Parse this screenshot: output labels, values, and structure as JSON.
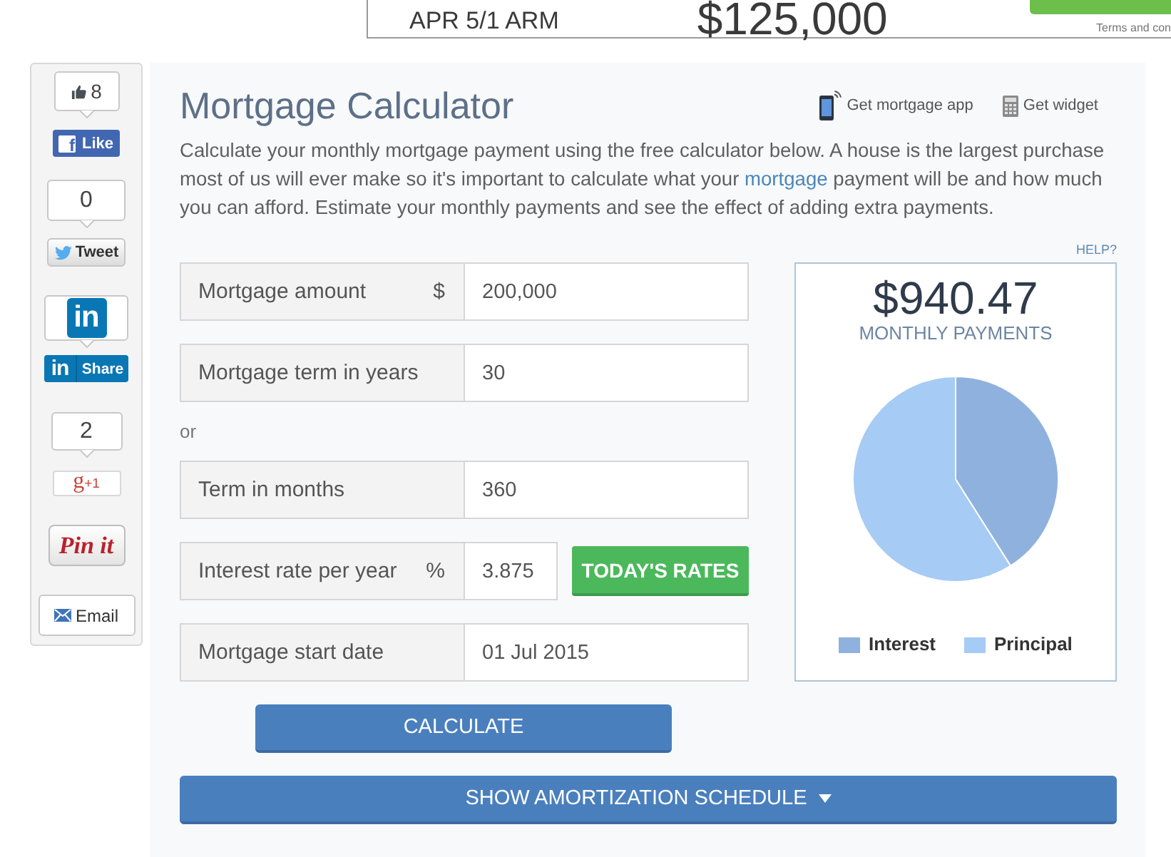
{
  "ad_banner": {
    "rate_type": "APR 5/1 ARM",
    "amount": "$125,000",
    "fine_print": "Terms and con"
  },
  "share_bar": [
    {
      "kind": "facebook",
      "count": "8",
      "logo": "f",
      "label": "Like"
    },
    {
      "kind": "twitter",
      "count": "0",
      "label": "Tweet"
    },
    {
      "kind": "linkedin",
      "logo": "in",
      "button_logo": "in",
      "label": "Share"
    },
    {
      "kind": "google",
      "count": "2",
      "logo": "g",
      "label": "+1"
    },
    {
      "kind": "pinterest",
      "label": "Pin it"
    },
    {
      "kind": "email",
      "label": "Email"
    }
  ],
  "calculator": {
    "title": "Mortgage Calculator",
    "links": [
      {
        "kind": "app",
        "label": "Get mortgage app"
      },
      {
        "kind": "widget",
        "label": "Get widget"
      }
    ],
    "intro": {
      "before": "Calculate your monthly mortgage payment using the free calculator below. A house is the largest purchase most of us will ever make so it's important to calculate what your ",
      "link": "mortgage",
      "after": " payment will be and how much you can afford. Estimate your monthly payments and see the effect of adding extra payments."
    },
    "help": "HELP?",
    "rows": [
      {
        "kind": "field",
        "label": "Mortgage amount",
        "unit": "$",
        "value": "200,000"
      },
      {
        "kind": "field",
        "label": "Mortgage term in years",
        "value": "30"
      },
      {
        "kind": "separator",
        "text": "or"
      },
      {
        "kind": "field",
        "label": "Term in months",
        "value": "360"
      },
      {
        "kind": "field",
        "label": "Interest rate per year",
        "unit": "%",
        "value": "3.875",
        "button": "TODAY'S RATES"
      },
      {
        "kind": "field",
        "label": "Mortgage start date",
        "value": "01 Jul 2015"
      }
    ],
    "calculate_button": "CALCULATE",
    "result": {
      "amount": "$940.47",
      "caption": "MONTHLY PAYMENTS",
      "legend": [
        {
          "label": "Interest",
          "color": "#8fb1de"
        },
        {
          "label": "Principal",
          "color": "#a6cbf5"
        }
      ]
    },
    "schedule_button": "SHOW AMORTIZATION SCHEDULE"
  }
}
